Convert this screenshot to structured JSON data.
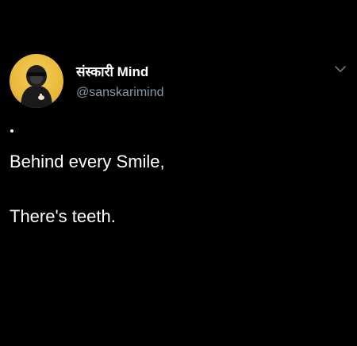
{
  "tweet": {
    "author": {
      "display_name": "संस्कारी Mind",
      "handle": "@sanskarimind",
      "avatar_icon": "hooded-figure-avatar"
    },
    "menu_icon": "chevron-down-icon",
    "separator": ".",
    "body_lines": [
      "Behind every Smile,",
      "There's teeth."
    ]
  },
  "colors": {
    "background": "#000000",
    "text": "#ffffff",
    "handle": "#8b98a5",
    "avatar_bg": "#e9b93a"
  }
}
